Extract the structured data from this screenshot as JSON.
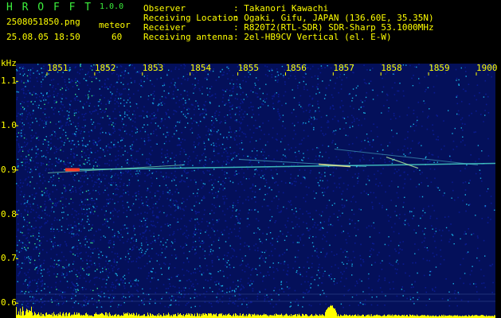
{
  "header": {
    "app_logo": "H R O F F T",
    "version": "1.0.0",
    "filename": "2508051850.png",
    "datetime": "25.08.05 18:50",
    "mode_label": "meteor",
    "count": "60",
    "info": [
      {
        "label": "Observer",
        "value": ": Takanori Kawachi"
      },
      {
        "label": "Receiving Location",
        "value": ": Ogaki, Gifu, JAPAN (136.60E, 35.35N)"
      },
      {
        "label": "Receiver",
        "value": ": R820T2(RTL-SDR) SDR-Sharp 53.1000MHz"
      },
      {
        "label": "Receiving antenna",
        "value": ": 2el-HB9CV Vertical (el. E-W)"
      }
    ]
  },
  "chart_data": {
    "type": "heatmap",
    "ylabel": "kHz",
    "x_ticks": [
      "1851",
      "1852",
      "1853",
      "1854",
      "1855",
      "1856",
      "1857",
      "1858",
      "1859",
      "1900"
    ],
    "y_ticks": [
      "1.1",
      "1.0",
      "0.9",
      "0.8",
      "0.7",
      "0.6"
    ],
    "y_tick_values": [
      1.1,
      1.0,
      0.9,
      0.8,
      0.7,
      0.6
    ],
    "ylim": [
      0.57,
      1.14
    ],
    "carrier_khz": 0.915,
    "colors": {
      "background": "#000000",
      "text": "#ffff00",
      "noise_low": "#0a1b8f",
      "noise_high": "#19b4e6",
      "trace": "#46d2c8",
      "meteor": "#ff3c28",
      "bottom_bars": "#ffff00"
    }
  }
}
